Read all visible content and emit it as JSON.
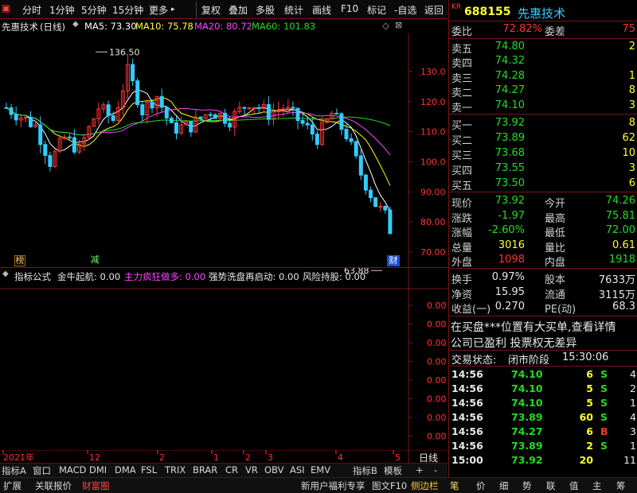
{
  "toolbar": {
    "items": [
      "分时",
      "1分钟",
      "5分钟",
      "15分钟",
      "更多",
      "复权",
      "叠加",
      "多股",
      "统计",
      "画线",
      "F10",
      "标记",
      "-自选",
      "返回"
    ]
  },
  "chart": {
    "stock_name": "先惠技术",
    "period": "(日线)",
    "ma5": "MA5: 73.30",
    "ma10": "MA10: 75.78",
    "ma20": "MA20: 80.72",
    "ma60": "MA60: 101.83",
    "high_label": "136.50",
    "low_label": "63.88",
    "y_ticks": [
      "130.0",
      "120.0",
      "110.0",
      "100.0",
      "90.00",
      "80.00",
      "70.00"
    ],
    "x_ticks": [
      "2021年",
      "12",
      "2",
      "1",
      "2",
      "3",
      "4",
      "5"
    ],
    "period_btn": "日线",
    "badges": [
      "榜",
      "减",
      "财"
    ],
    "colors": {
      "ma5": "#ffffff",
      "ma10": "#ffff00",
      "ma20": "#ff44ff",
      "ma60": "#22dd22",
      "up": "#ff3333",
      "down": "#33ccff"
    }
  },
  "indicator": {
    "name": "指标公式",
    "jnqh": "金牛起航: 0.00",
    "zlfk": "主力疯狂做多: 0.00",
    "qsxp": "强势洗盘再启动: 0.00",
    "fxcg": "风险持股: 0.00",
    "y_ticks": [
      "0.00",
      "0.00",
      "0.00",
      "0.00",
      "0.00",
      "0.00",
      "0.00",
      "0.00",
      "0.00"
    ]
  },
  "bottom_tabs": [
    "指标A",
    "窗口",
    "MACD",
    "DMI",
    "DMA",
    "FSL",
    "TRIX",
    "BRAR",
    "CR",
    "VR",
    "OBV",
    "ASI",
    "EMV",
    "指标B",
    "模板",
    "+",
    "-"
  ],
  "bottom_bar": [
    "扩展",
    "关联报价",
    "财富圈",
    "新用户福利专享",
    "图文F10",
    "侧边栏"
  ],
  "right_tabs": [
    "笔",
    "价",
    "细",
    "势",
    "联",
    "值",
    "主",
    "筹"
  ],
  "quote": {
    "tag": "KR",
    "code": "688155",
    "name": "先惠技术",
    "webi_label": "委比",
    "webi": "72.82%",
    "weicha_label": "委差",
    "weicha": "75",
    "asks": [
      {
        "label": "卖五",
        "price": "74.80",
        "vol": "2"
      },
      {
        "label": "卖四",
        "price": "74.32",
        "vol": ""
      },
      {
        "label": "卖三",
        "price": "74.28",
        "vol": "1"
      },
      {
        "label": "卖二",
        "price": "74.27",
        "vol": "8"
      },
      {
        "label": "卖一",
        "price": "74.10",
        "vol": "3"
      }
    ],
    "bids": [
      {
        "label": "买一",
        "price": "73.92",
        "vol": "8"
      },
      {
        "label": "买二",
        "price": "73.89",
        "vol": "62"
      },
      {
        "label": "买三",
        "price": "73.68",
        "vol": "10"
      },
      {
        "label": "买四",
        "price": "73.55",
        "vol": "3"
      },
      {
        "label": "买五",
        "price": "73.50",
        "vol": "6"
      }
    ],
    "stats": [
      {
        "l1": "现价",
        "v1": "73.92",
        "c1": "green",
        "l2": "今开",
        "v2": "74.26",
        "c2": "green"
      },
      {
        "l1": "涨跌",
        "v1": "-1.97",
        "c1": "green",
        "l2": "最高",
        "v2": "75.81",
        "c2": "green"
      },
      {
        "l1": "涨幅",
        "v1": "-2.60%",
        "c1": "green",
        "l2": "最低",
        "v2": "72.00",
        "c2": "green"
      },
      {
        "l1": "总量",
        "v1": "3016",
        "c1": "yellow",
        "l2": "量比",
        "v2": "0.61",
        "c2": "yellow"
      },
      {
        "l1": "外盘",
        "v1": "1098",
        "c1": "red",
        "l2": "内盘",
        "v2": "1918",
        "c2": "green"
      }
    ],
    "stats2": [
      {
        "l1": "换手",
        "v1": "0.97%",
        "l2": "股本",
        "v2": "7633万"
      },
      {
        "l1": "净资",
        "v1": "15.95",
        "l2": "流通",
        "v2": "3115万"
      },
      {
        "l1": "收益(一)",
        "v1": "0.270",
        "l2": "PE(动)",
        "v2": "68.3"
      }
    ],
    "news1": "在买盘***位置有大买单,查看详情",
    "news2": "公司已盈利 投票权无差异",
    "status_label": "交易状态:",
    "status": "闭市阶段",
    "status_time": "15:30:06",
    "ticks": [
      {
        "t": "14:56",
        "p": "74.10",
        "v": "6",
        "d": "S",
        "n": "4"
      },
      {
        "t": "14:56",
        "p": "74.10",
        "v": "5",
        "d": "S",
        "n": "2"
      },
      {
        "t": "14:56",
        "p": "74.10",
        "v": "5",
        "d": "S",
        "n": "1"
      },
      {
        "t": "14:56",
        "p": "73.89",
        "v": "60",
        "d": "S",
        "n": "4"
      },
      {
        "t": "14:56",
        "p": "74.27",
        "v": "6",
        "d": "B",
        "n": "3"
      },
      {
        "t": "14:56",
        "p": "73.89",
        "v": "2",
        "d": "S",
        "n": "1"
      },
      {
        "t": "15:00",
        "p": "73.92",
        "v": "20",
        "d": "",
        "n": "11"
      }
    ]
  }
}
